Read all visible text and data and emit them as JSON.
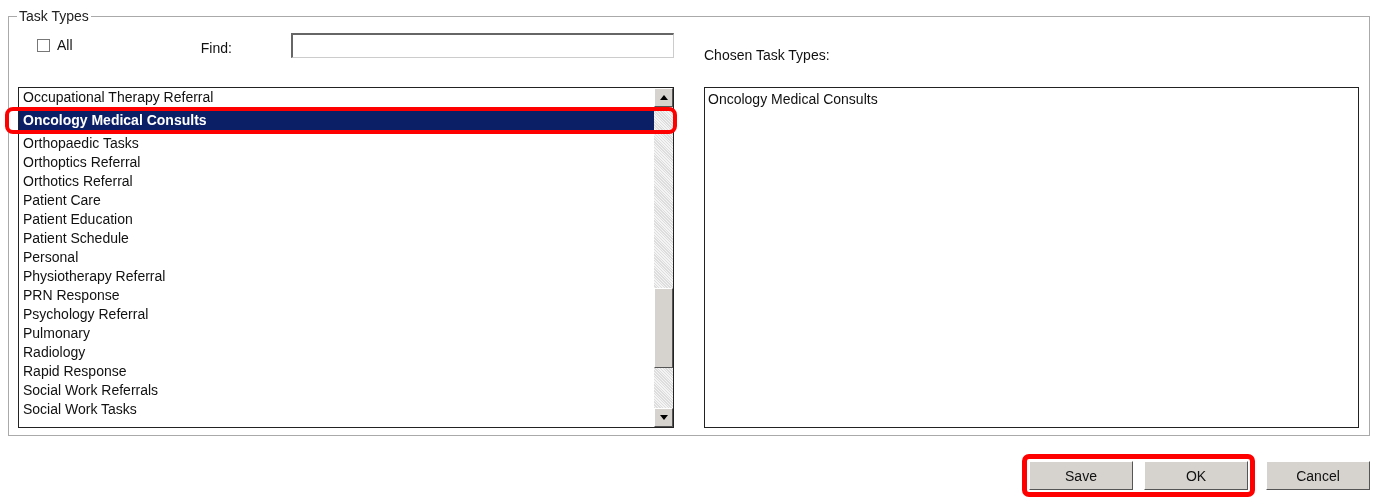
{
  "group": {
    "legend": "Task Types"
  },
  "all_checkbox": {
    "label": "All",
    "checked": false
  },
  "find": {
    "label": "Find:"
  },
  "chosen_label": "Chosen Task Types:",
  "task_types": [
    {
      "label": "Occupational Therapy Referral",
      "selected": false,
      "highlighted": false
    },
    {
      "label": "Oncology Medical Consults",
      "selected": true,
      "highlighted": true
    },
    {
      "label": "Orthopaedic Tasks",
      "selected": false,
      "highlighted": false
    },
    {
      "label": "Orthoptics Referral",
      "selected": false,
      "highlighted": false
    },
    {
      "label": "Orthotics Referral",
      "selected": false,
      "highlighted": false
    },
    {
      "label": "Patient Care",
      "selected": false,
      "highlighted": false
    },
    {
      "label": "Patient Education",
      "selected": false,
      "highlighted": false
    },
    {
      "label": "Patient Schedule",
      "selected": false,
      "highlighted": false
    },
    {
      "label": "Personal",
      "selected": false,
      "highlighted": false
    },
    {
      "label": "Physiotherapy Referral",
      "selected": false,
      "highlighted": false
    },
    {
      "label": "PRN Response",
      "selected": false,
      "highlighted": false
    },
    {
      "label": "Psychology Referral",
      "selected": false,
      "highlighted": false
    },
    {
      "label": "Pulmonary",
      "selected": false,
      "highlighted": false
    },
    {
      "label": "Radiology",
      "selected": false,
      "highlighted": false
    },
    {
      "label": "Rapid Response",
      "selected": false,
      "highlighted": false
    },
    {
      "label": "Social Work Referrals",
      "selected": false,
      "highlighted": false
    },
    {
      "label": "Social Work Tasks",
      "selected": false,
      "highlighted": false
    }
  ],
  "chosen_task_types": [
    "Oncology Medical Consults"
  ],
  "buttons": [
    {
      "label": "Save",
      "highlighted": true
    },
    {
      "label": "OK",
      "highlighted": true
    },
    {
      "label": "Cancel",
      "highlighted": false
    }
  ]
}
